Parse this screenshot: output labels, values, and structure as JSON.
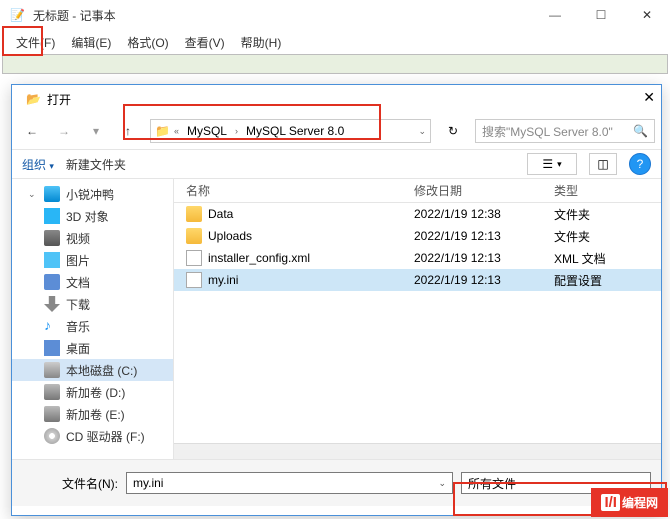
{
  "notepad": {
    "icon": "notepad-icon",
    "title": "无标题 - 记事本",
    "menu": {
      "file": "文件(F)",
      "edit": "编辑(E)",
      "format": "格式(O)",
      "view": "查看(V)",
      "help": "帮助(H)"
    }
  },
  "dialog": {
    "title": "打开",
    "breadcrumb": {
      "seg1": "MySQL",
      "seg2": "MySQL Server 8.0"
    },
    "search_placeholder": "搜索\"MySQL Server 8.0\"",
    "toolbar": {
      "organize": "组织",
      "newfolder": "新建文件夹"
    },
    "sidebar": {
      "root": "小锐冲鸭",
      "items": [
        "3D 对象",
        "视频",
        "图片",
        "文档",
        "下载",
        "音乐",
        "桌面",
        "本地磁盘 (C:)",
        "新加卷 (D:)",
        "新加卷 (E:)",
        "CD 驱动器 (F:)"
      ]
    },
    "columns": {
      "name": "名称",
      "date": "修改日期",
      "type": "类型"
    },
    "rows": [
      {
        "icon": "folder",
        "name": "Data",
        "date": "2022/1/19 12:38",
        "type": "文件夹"
      },
      {
        "icon": "folder",
        "name": "Uploads",
        "date": "2022/1/19 12:13",
        "type": "文件夹"
      },
      {
        "icon": "xml",
        "name": "installer_config.xml",
        "date": "2022/1/19 12:13",
        "type": "XML 文档"
      },
      {
        "icon": "ini",
        "name": "my.ini",
        "date": "2022/1/19 12:13",
        "type": "配置设置",
        "sel": true
      }
    ],
    "footer": {
      "filename_label": "文件名(N):",
      "filename_value": "my.ini",
      "filetype": "所有文件"
    }
  },
  "logo": {
    "brand": "编程网",
    "mark": "I/I"
  }
}
